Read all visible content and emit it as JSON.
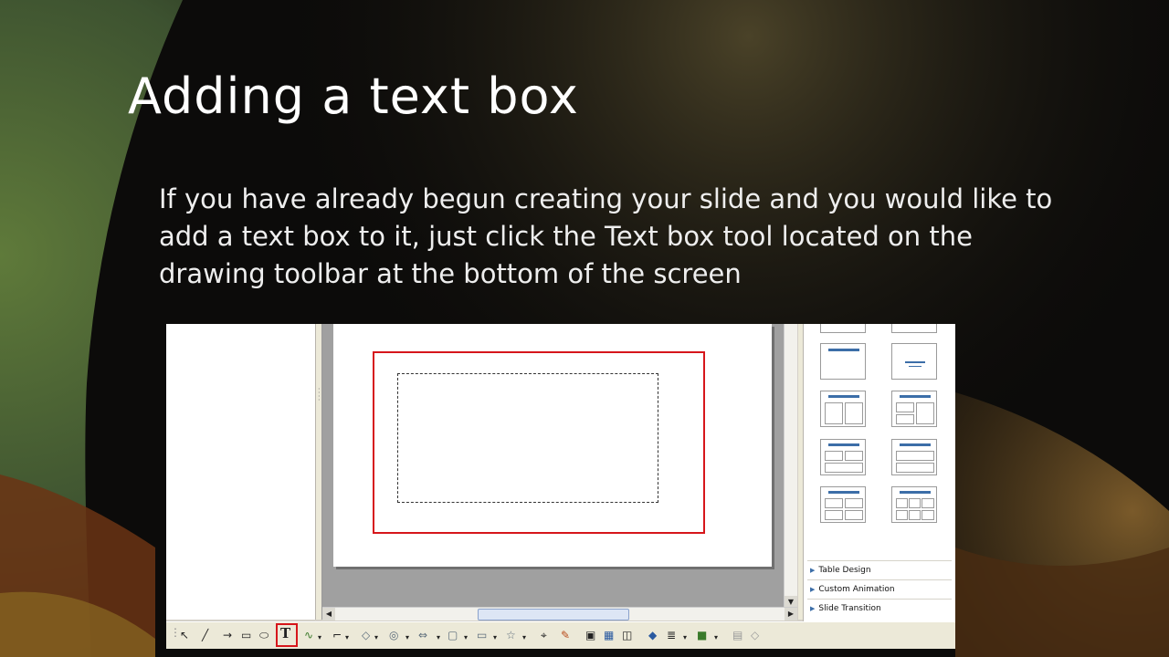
{
  "slide": {
    "title": "Adding a text box",
    "body": "If you have already begun creating your slide and you would like to add a text box to it, just click the Text box tool located on the drawing toolbar at the bottom of the screen"
  },
  "task_panel": {
    "items": [
      {
        "label": "Table Design"
      },
      {
        "label": "Custom Animation"
      },
      {
        "label": "Slide Transition"
      }
    ]
  },
  "colors": {
    "highlight": "#d6161b",
    "toolbar": "#ece9d8",
    "layout_title": "#3c6ea8"
  },
  "toolbar": {
    "tools": [
      "select-icon",
      "line-icon",
      "arrow-icon",
      "rectangle-icon",
      "ellipse-icon",
      "text-box-icon",
      "curve-icon",
      "connector-icon",
      "basic-shapes-icon",
      "symbol-shapes-icon",
      "block-arrows-icon",
      "flowchart-icon",
      "callouts-icon",
      "stars-icon",
      "points-icon",
      "glue-icon",
      "from-file-icon",
      "gallery-icon",
      "extrusion-icon",
      "alignment-icon",
      "arrange-icon",
      "shadow-icon",
      "toggle-icon"
    ],
    "highlighted_tool": "text-box-icon"
  }
}
